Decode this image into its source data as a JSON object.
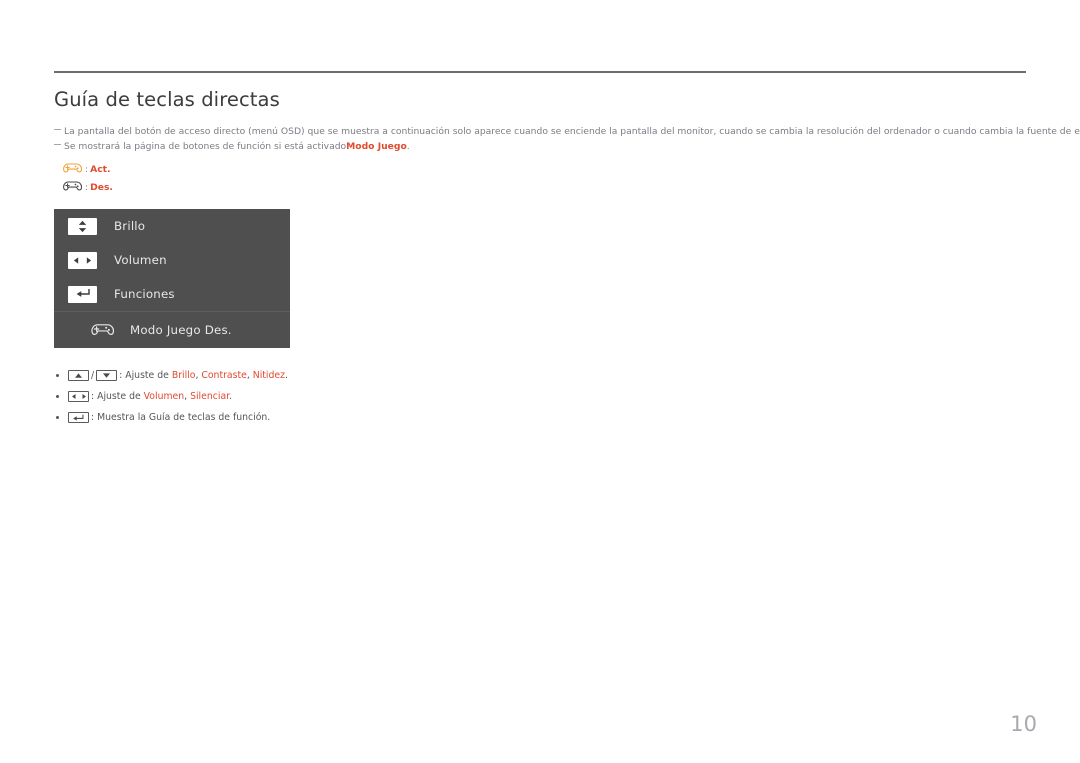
{
  "document": {
    "title": "Guía de teclas directas",
    "page_number": "10",
    "accent_color": "#e04a2f",
    "osd_background": "#4f4f4f"
  },
  "notes": [
    {
      "marker": "—",
      "text": "La pantalla del botón de acceso directo (menú OSD) que se muestra a continuación solo aparece cuando se enciende la pantalla del monitor, cuando se cambia la resolución del ordenador o cuando cambia la fuente de entrada."
    },
    {
      "marker": "—",
      "text_before": "Se mostrará la página de botones de función si está activado ",
      "highlight": "Modo Juego",
      "text_after": "."
    }
  ],
  "legend": [
    {
      "icon": "gamepad-icon-on",
      "icon_color": "#f0a23c",
      "separator": ":",
      "label": "Act."
    },
    {
      "icon": "gamepad-icon-off",
      "icon_color": "#4a4a4a",
      "separator": ":",
      "label": "Des."
    }
  ],
  "osd_menu": {
    "rows": [
      {
        "icon": "up-down-arrows-icon",
        "label": "Brillo"
      },
      {
        "icon": "left-right-arrows-icon",
        "label": "Volumen"
      },
      {
        "icon": "enter-return-icon",
        "label": "Funciones"
      }
    ],
    "game_row": {
      "icon": "gamepad-icon",
      "label": "Modo Juego Des."
    }
  },
  "key_guide": [
    {
      "keys": [
        "up-arrow-key",
        "down-arrow-key"
      ],
      "separator": "/",
      "colon": ": ",
      "prefix": "Ajuste de ",
      "items": [
        "Brillo",
        "Contraste",
        "Nitidez"
      ],
      "suffix": "."
    },
    {
      "keys": [
        "left-right-arrow-key"
      ],
      "separator": "",
      "colon": ": ",
      "prefix": "Ajuste de ",
      "items": [
        "Volumen",
        "Silenciar"
      ],
      "suffix": "."
    },
    {
      "keys": [
        "enter-key"
      ],
      "separator": "",
      "colon": ": ",
      "prefix": "Muestra la Guía de teclas de función.",
      "items": [],
      "suffix": ""
    }
  ]
}
